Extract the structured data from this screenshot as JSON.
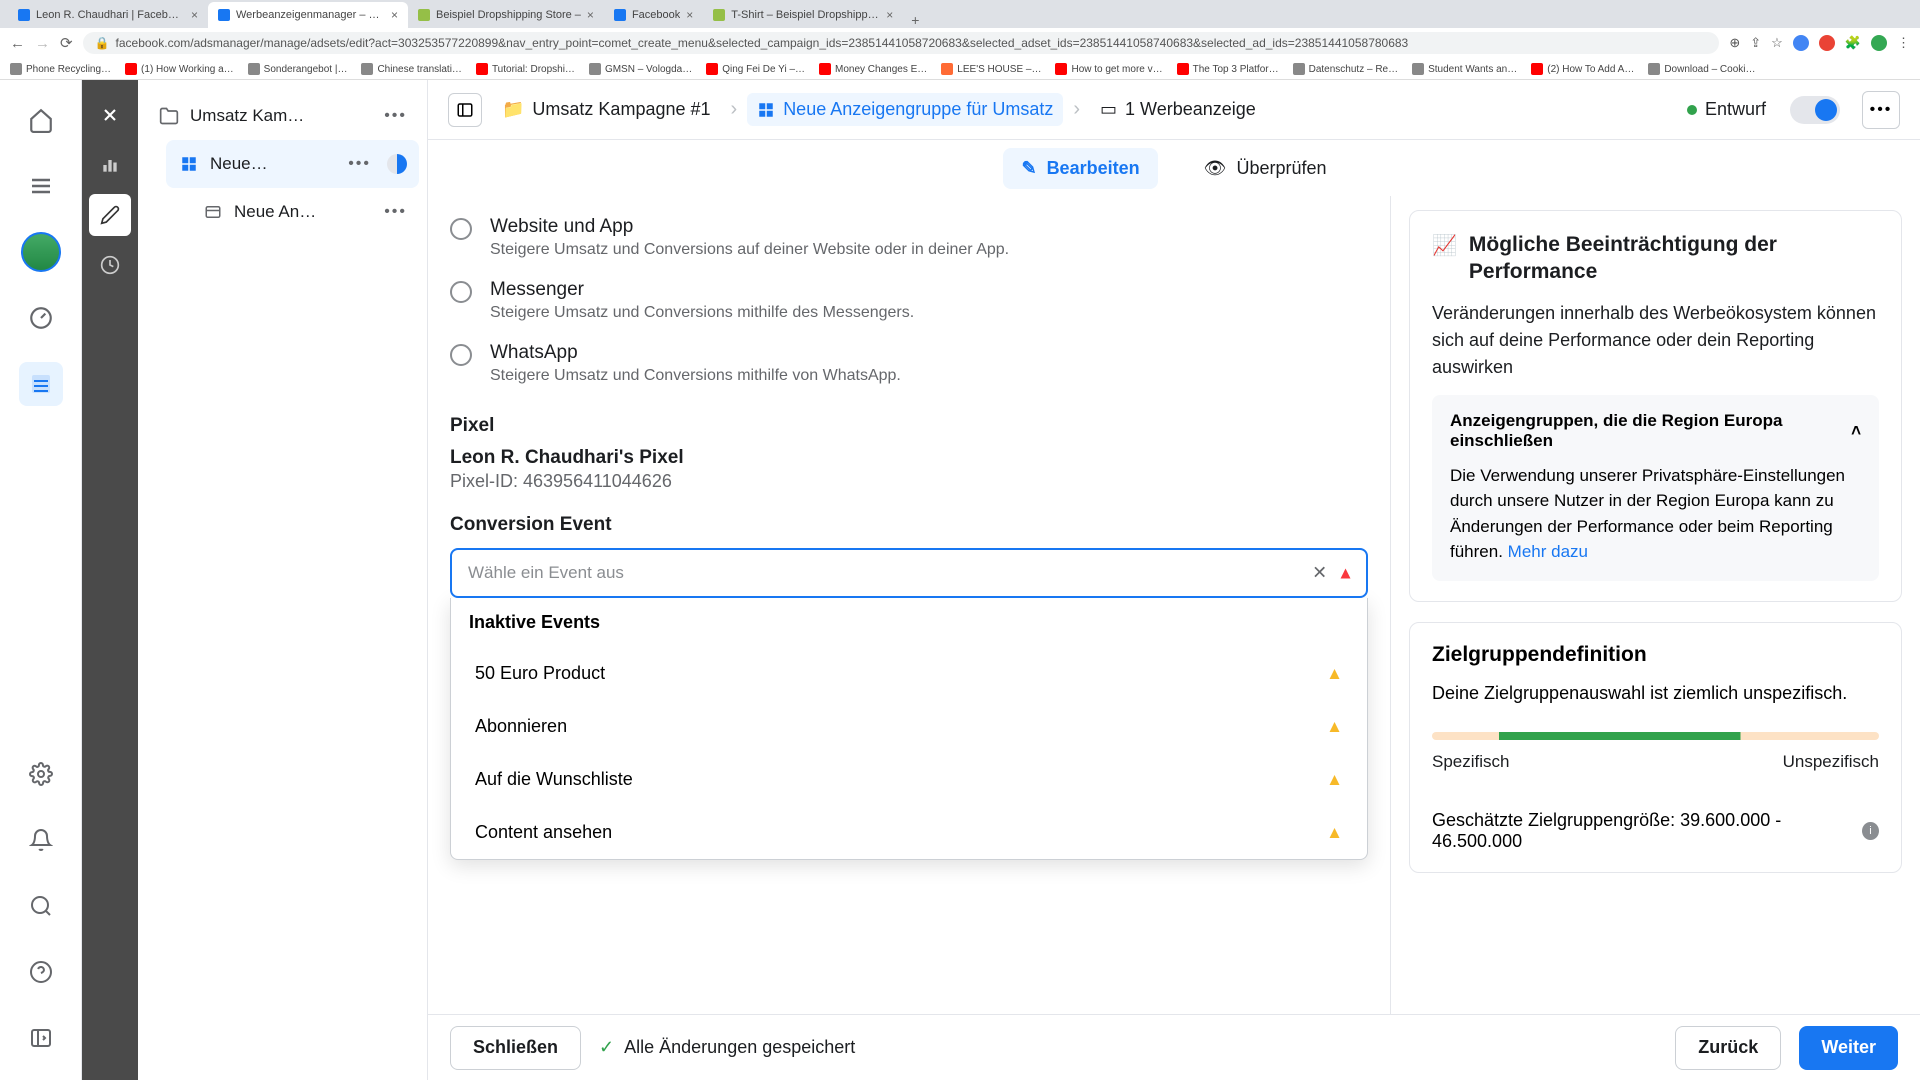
{
  "browser": {
    "tabs": [
      {
        "title": "Leon R. Chaudhari | Facebook"
      },
      {
        "title": "Werbeanzeigenmanager – We…"
      },
      {
        "title": "Beispiel Dropshipping Store –"
      },
      {
        "title": "Facebook"
      },
      {
        "title": "T-Shirt – Beispiel Dropshippin…"
      }
    ],
    "url": "facebook.com/adsmanager/manage/adsets/edit?act=303253577220899&nav_entry_point=comet_create_menu&selected_campaign_ids=23851441058720683&selected_adset_ids=23851441058740683&selected_ad_ids=23851441058780683",
    "bookmarks": [
      "Phone Recycling…",
      "(1) How Working a…",
      "Sonderangebot |…",
      "Chinese translati…",
      "Tutorial: Dropshi…",
      "GMSN – Vologda…",
      "Qing Fei De Yi –…",
      "Money Changes E…",
      "LEE'S HOUSE –…",
      "How to get more v…",
      "The Top 3 Platfor…",
      "Datenschutz – Re…",
      "Student Wants an…",
      "(2) How To Add A…",
      "Download – Cooki…"
    ]
  },
  "tree": {
    "campaign": "Umsatz Kam…",
    "adset": "Neue…",
    "ad": "Neue An…"
  },
  "breadcrumb": {
    "campaign": "Umsatz Kampagne #1",
    "adset": "Neue Anzeigengruppe für Umsatz",
    "ad": "1 Werbeanzeige",
    "status": "Entwurf"
  },
  "tabs": {
    "edit": "Bearbeiten",
    "review": "Überprüfen"
  },
  "conversion_locations": [
    {
      "title": "Website und App",
      "desc": "Steigere Umsatz und Conversions auf deiner Website oder in deiner App."
    },
    {
      "title": "Messenger",
      "desc": "Steigere Umsatz und Conversions mithilfe des Messengers."
    },
    {
      "title": "WhatsApp",
      "desc": "Steigere Umsatz und Conversions mithilfe von WhatsApp."
    }
  ],
  "pixel": {
    "section": "Pixel",
    "name": "Leon R. Chaudhari's Pixel",
    "id_label": "Pixel-ID: 463956411044626"
  },
  "event": {
    "section": "Conversion Event",
    "placeholder": "Wähle ein Event aus",
    "group_header": "Inaktive Events",
    "options": [
      "50 Euro Product",
      "Abonnieren",
      "Auf die Wunschliste",
      "Content ansehen"
    ]
  },
  "right": {
    "perf_title": "Mögliche Beeinträchtigung der Performance",
    "perf_text": "Veränderungen innerhalb des Werbeökosystem können sich auf deine Performance oder dein Reporting auswirken",
    "eu_header": "Anzeigengruppen, die die Region Europa einschließen",
    "eu_text": "Die Verwendung unserer Privatsphäre-Einstellungen durch unsere Nutzer in der Region Europa kann zu Änderungen der Performance oder beim Reporting führen. ",
    "eu_link": "Mehr dazu",
    "aud_title": "Zielgruppendefinition",
    "aud_text": "Deine Zielgruppenauswahl ist ziemlich unspezifisch.",
    "gauge_left": "Spezifisch",
    "gauge_right": "Unspezifisch",
    "aud_size": "Geschätzte Zielgruppengröße: 39.600.000 - 46.500.000"
  },
  "footer": {
    "close": "Schließen",
    "saved": "Alle Änderungen gespeichert",
    "back": "Zurück",
    "next": "Weiter"
  }
}
